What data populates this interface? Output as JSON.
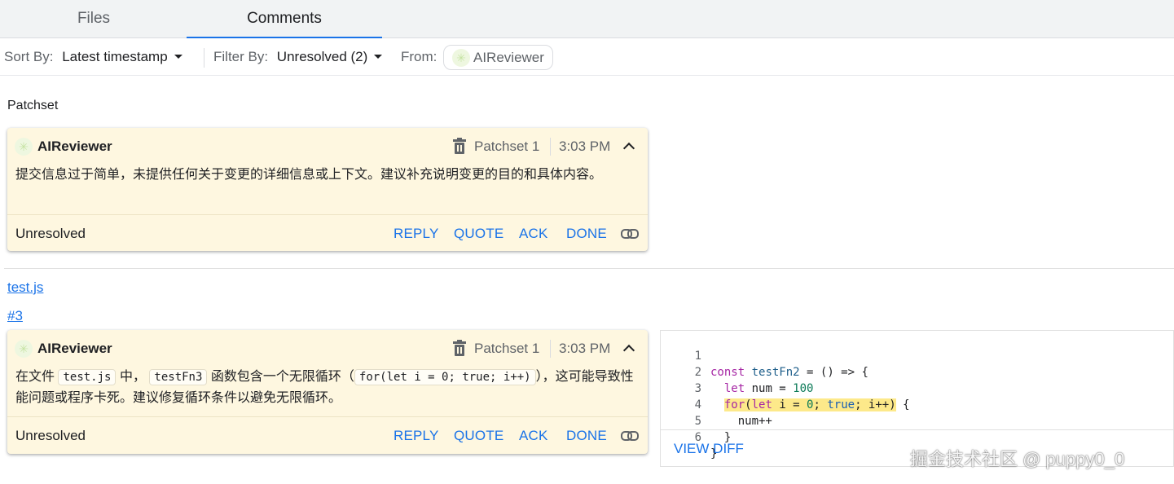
{
  "tabs": [
    {
      "label": "Files",
      "active": false
    },
    {
      "label": "Comments",
      "active": true
    }
  ],
  "filters": {
    "sort_label": "Sort By:",
    "sort_value": "Latest timestamp",
    "filter_label": "Filter By:",
    "filter_value": "Unresolved (2)",
    "from_label": "From:",
    "from_value": "AIReviewer"
  },
  "sections": {
    "patchset_title": "Patchset",
    "file_link": "test.js",
    "line_link": "#3"
  },
  "comments": [
    {
      "author": "AIReviewer",
      "patchset": "Patchset 1",
      "time": "3:03 PM",
      "body": "提交信息过于简单，未提供任何关于变更的详细信息或上下文。建议补充说明变更的目的和具体内容。",
      "status": "Unresolved",
      "actions": [
        "REPLY",
        "QUOTE",
        "ACK",
        "DONE"
      ]
    },
    {
      "author": "AIReviewer",
      "patchset": "Patchset 1",
      "time": "3:03 PM",
      "body_parts": {
        "p1": "在文件",
        "c1": "test.js",
        "p2": "中，",
        "c2": "testFn3",
        "p3": "函数包含一个无限循环（",
        "c3": "for(let i = 0; true; i++)",
        "p4": "），这可能导致性能问题或程序卡死。建议修复循环条件以避免无限循环。"
      },
      "status": "Unresolved",
      "actions": [
        "REPLY",
        "QUOTE",
        "ACK",
        "DONE"
      ]
    }
  ],
  "code_snippet": {
    "lines": [
      {
        "n": "1",
        "text": "const testFn2 = () => {"
      },
      {
        "n": "2",
        "text": "  let num = 100"
      },
      {
        "n": "3",
        "text": "  for(let i = 0; true; i++) {"
      },
      {
        "n": "4",
        "text": "    num++"
      },
      {
        "n": "5",
        "text": "  }"
      },
      {
        "n": "6",
        "text": "}"
      }
    ],
    "highlighted_line": 3,
    "view_diff_label": "VIEW DIFF"
  },
  "watermark": "掘金技术社区 @ puppy0_0",
  "colors": {
    "accent": "#1a73e8",
    "card_bg": "#fef7e0",
    "highlight": "#fde98a"
  }
}
